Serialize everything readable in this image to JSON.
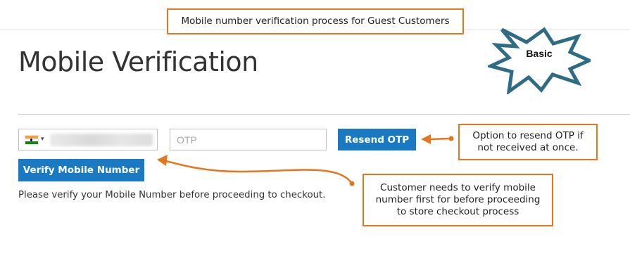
{
  "annotations": {
    "top_callout": "Mobile number verification process for Guest Customers",
    "badge": "Basic",
    "resend_callout": "Option to resend OTP if not received at once.",
    "verify_callout": "Customer needs to verify mobile number first for before proceeding to store checkout process"
  },
  "page": {
    "title": "Mobile Verification"
  },
  "form": {
    "country_flag": "india-flag-icon",
    "otp_placeholder": "OTP",
    "resend_label": "Resend OTP",
    "verify_label": "Verify Mobile Number",
    "help_text": "Please verify your Mobile Number before proceeding to checkout."
  },
  "colors": {
    "accent": "#1979c3",
    "annotation": "#e5761e",
    "badge_fill": "#ffffff",
    "badge_stroke": "#2e6b84"
  }
}
